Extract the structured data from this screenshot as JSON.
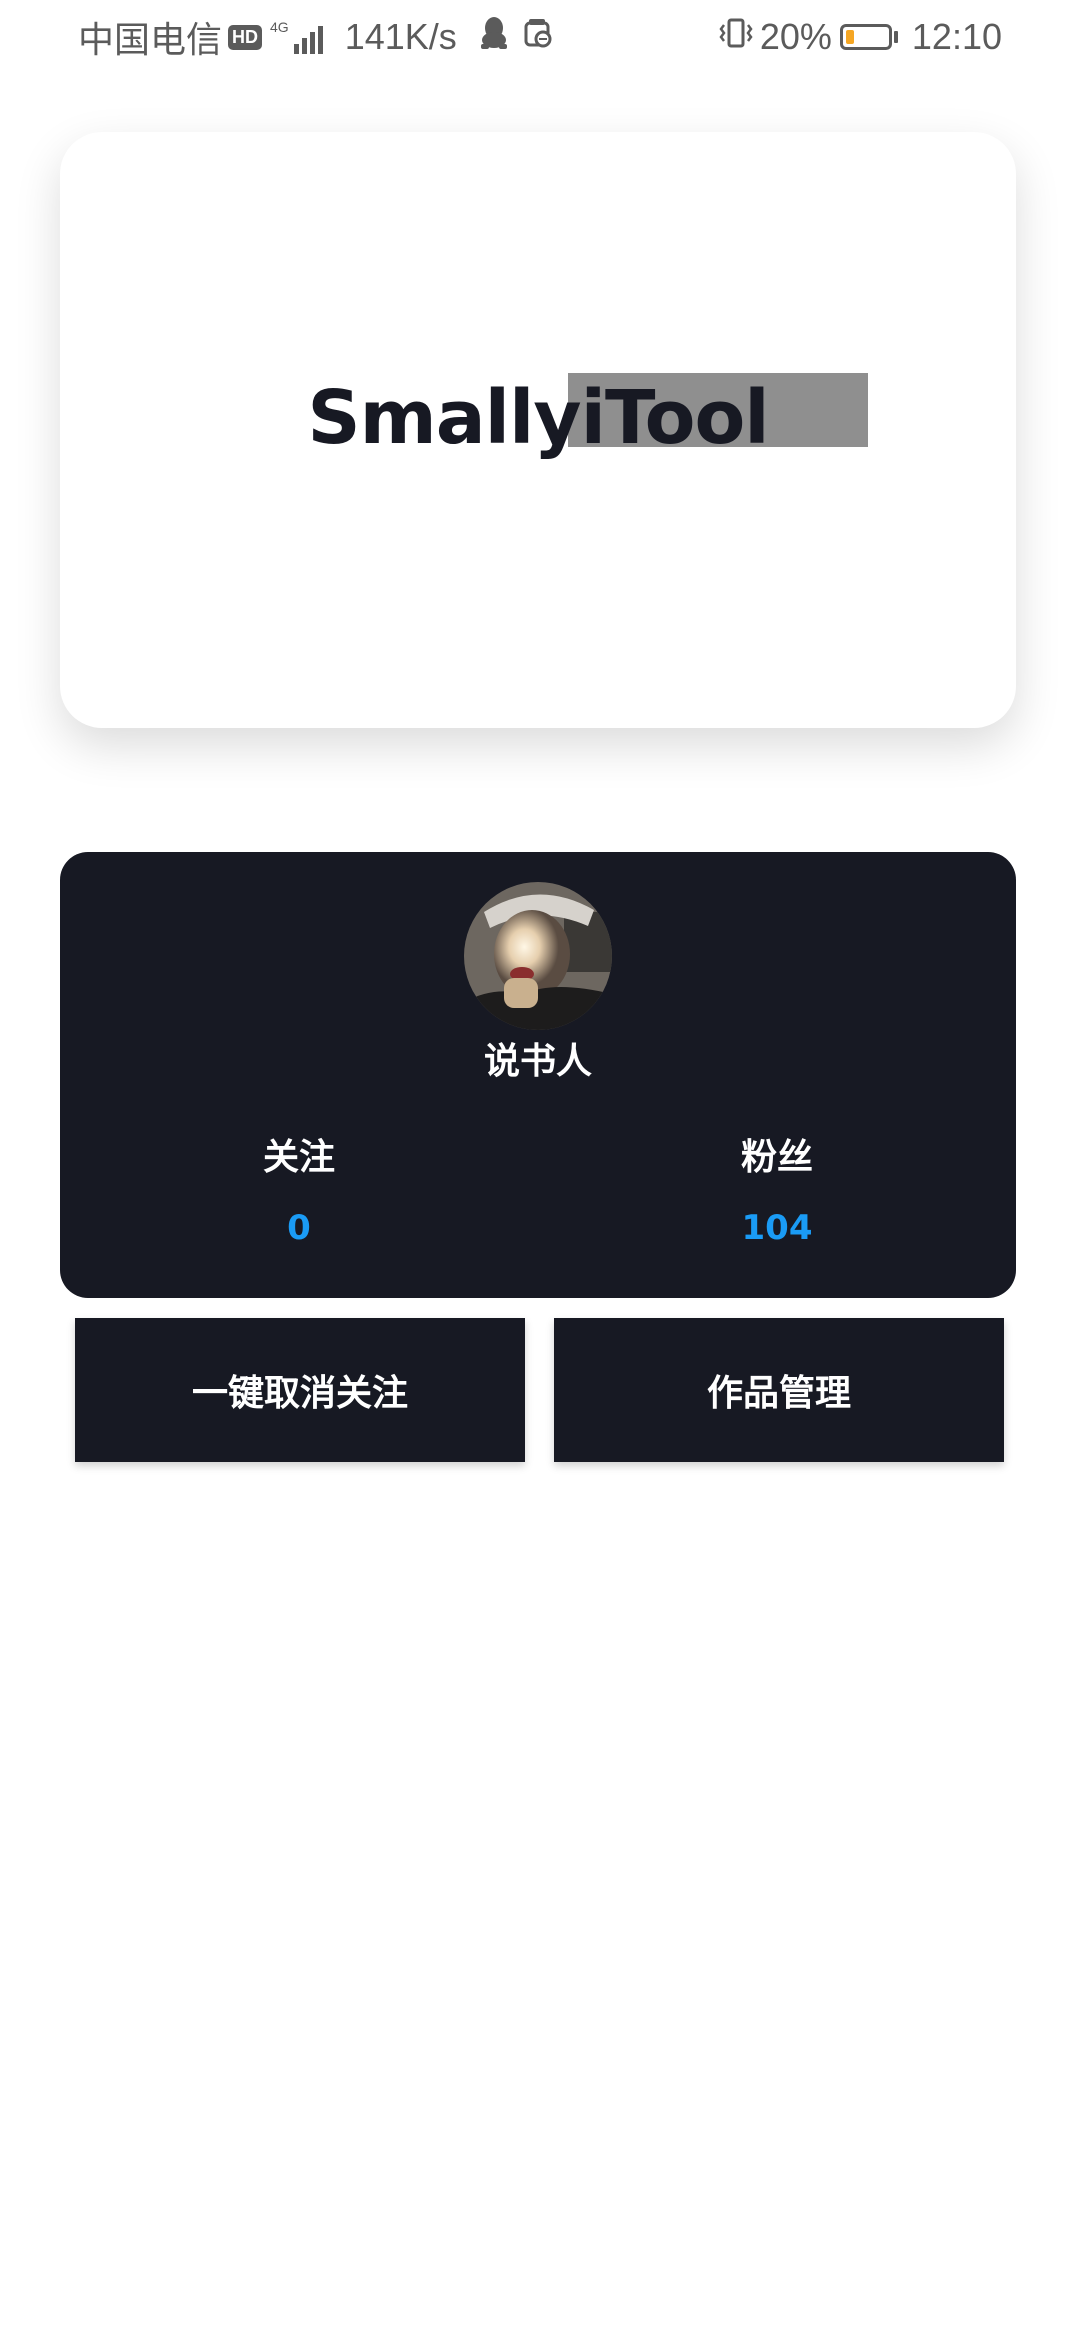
{
  "status_bar": {
    "carrier": "中国电信",
    "hd": "HD",
    "network": "4G",
    "speed": "141K/s",
    "battery_percent": "20%",
    "battery_level": 0.2,
    "time": "12:10",
    "icons": [
      "hd-icon",
      "signal-icon",
      "qq-penguin-icon",
      "notification-icon",
      "vibrate-icon",
      "battery-icon"
    ]
  },
  "logo": {
    "text": "SmallyiTool"
  },
  "profile": {
    "username": "说书人",
    "stats": {
      "following_label": "关注",
      "following_value": "0",
      "followers_label": "粉丝",
      "followers_value": "104"
    }
  },
  "actions": {
    "unfollow_all": "一键取消关注",
    "works_manage": "作品管理"
  },
  "colors": {
    "dark_card": "#171923",
    "accent_blue": "#1a9bf5",
    "battery_orange": "#f5a623"
  }
}
